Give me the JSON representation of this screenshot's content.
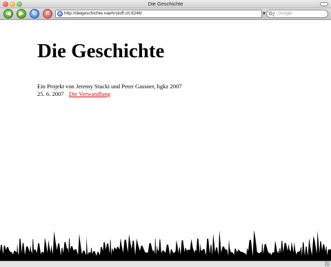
{
  "window": {
    "title": "Die Geschichte"
  },
  "toolbar": {
    "back_icon": "back-arrow-icon",
    "forward_icon": "forward-arrow-icon",
    "reload_icon": "reload-icon",
    "stop_icon": "stop-icon",
    "url": "http://diegeschichte.naehrstoff.ch:8246/",
    "search_placeholder": "Google"
  },
  "page": {
    "title": "Die Geschichte",
    "credit": "Ein Projekt von Jeremy Stucki und Peter Gassner, hgkz 2007",
    "entries": [
      {
        "date": "25. 6. 2007",
        "link_text": "Die Verwandlung"
      }
    ]
  },
  "colors": {
    "link": "#e60000",
    "crowd": "#000000"
  }
}
